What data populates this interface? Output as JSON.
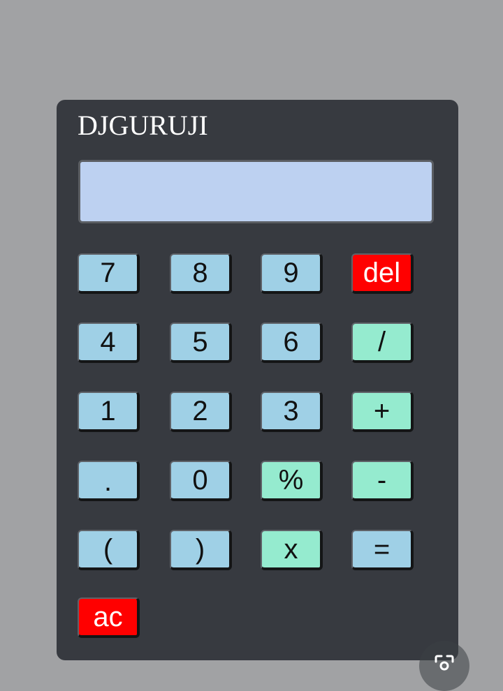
{
  "app": {
    "brand": "DJGURUJI"
  },
  "display": {
    "value": ""
  },
  "keys": {
    "seven": "7",
    "eight": "8",
    "nine": "9",
    "del": "del",
    "four": "4",
    "five": "5",
    "six": "6",
    "divide": "/",
    "one": "1",
    "two": "2",
    "three": "3",
    "plus": "+",
    "dot": ".",
    "zero": "0",
    "percent": "%",
    "minus": "-",
    "lparen": "(",
    "rparen": ")",
    "multiply": "x",
    "equals": "=",
    "ac": "ac"
  },
  "overlay": {
    "icon": "lens-search-icon"
  },
  "colors": {
    "page_background": "#a1a2a4",
    "body": "#373a40",
    "display": "#bdd1f1",
    "number_key": "#9fd0e6",
    "operator_key": "#95ebcf",
    "danger_key": "#ff0000"
  }
}
